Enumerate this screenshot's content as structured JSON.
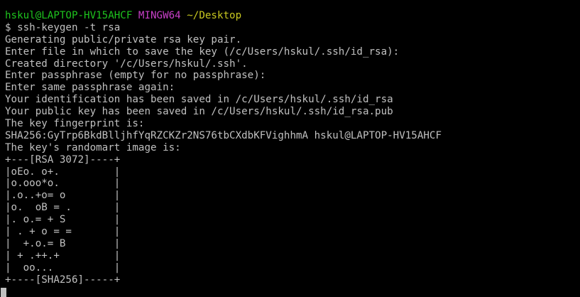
{
  "prompt": {
    "user_host": "hskul@LAPTOP-HV15AHCF",
    "shell": "MINGW64",
    "cwd": "~/Desktop"
  },
  "command_line": "$ ssh-keygen -t rsa",
  "output": [
    "Generating public/private rsa key pair.",
    "Enter file in which to save the key (/c/Users/hskul/.ssh/id_rsa):",
    "Created directory '/c/Users/hskul/.ssh'.",
    "Enter passphrase (empty for no passphrase):",
    "Enter same passphrase again:",
    "Your identification has been saved in /c/Users/hskul/.ssh/id_rsa",
    "Your public key has been saved in /c/Users/hskul/.ssh/id_rsa.pub",
    "The key fingerprint is:",
    "SHA256:GyTrp6BkdBlljhfYqRZCKZr2NS76tbCXdbKFVighhmA hskul@LAPTOP-HV15AHCF",
    "The key's randomart image is:",
    "+---[RSA 3072]----+",
    "|oEo. o+.         |",
    "|o.ooo*o.         |",
    "|.o..+o= o        |",
    "|o.  oB = .       |",
    "|. o.= + S        |",
    "| . + o = =       |",
    "|  +.o.= B        |",
    "| + .++.+         |",
    "|  oo...          |",
    "+----[SHA256]-----+"
  ]
}
